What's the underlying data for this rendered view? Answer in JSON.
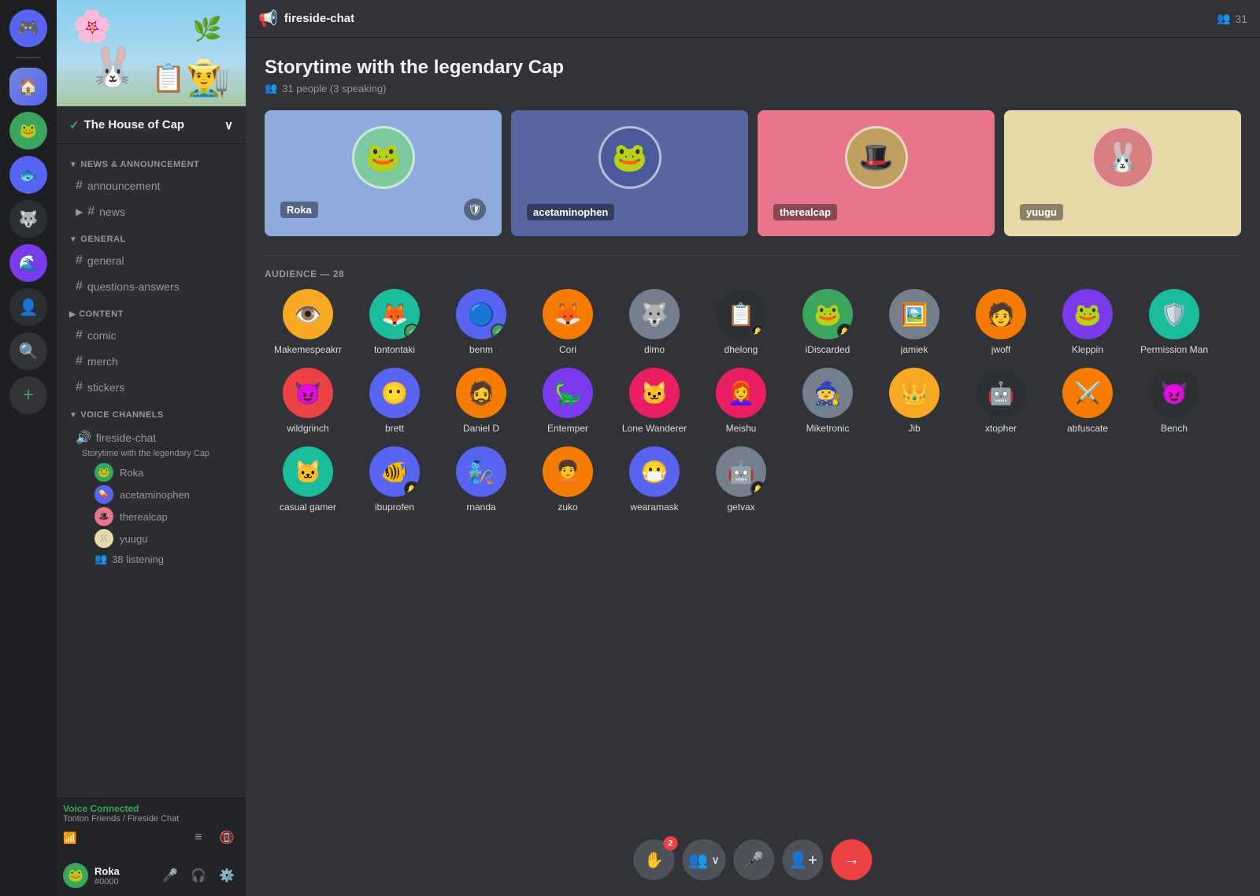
{
  "app": {
    "title": "DISCORD"
  },
  "server": {
    "name": "The House of Cap",
    "banner_alt": "Server Banner"
  },
  "channel_header": {
    "icon": "📢",
    "name": "fireside-chat",
    "members_count": "31"
  },
  "stage": {
    "title": "Storytime with the legendary Cap",
    "meta": "31 people (3 speaking)",
    "audience_label": "AUDIENCE — 28"
  },
  "speakers": [
    {
      "name": "Roka",
      "color": "blue",
      "has_badge": true
    },
    {
      "name": "acetaminophen",
      "color": "dark-blue",
      "has_badge": false
    },
    {
      "name": "therealcap",
      "color": "pink",
      "has_badge": false
    },
    {
      "name": "yuugu",
      "color": "yellow",
      "has_badge": false
    }
  ],
  "categories": {
    "news": "NEWS & ANNOUNCEMENT",
    "general": "GENERAL",
    "content": "CONTENT",
    "voice": "VOICE CHANNELS"
  },
  "channels": {
    "news_announcement": [
      {
        "name": "announcement"
      },
      {
        "name": "news"
      }
    ],
    "general": [
      {
        "name": "general"
      },
      {
        "name": "questions-answers"
      }
    ],
    "content": [
      {
        "name": "comic"
      },
      {
        "name": "merch"
      },
      {
        "name": "stickers"
      }
    ]
  },
  "voice_channel": {
    "name": "fireside-chat",
    "subtitle": "Storytime with the legendary Cap",
    "members": [
      {
        "name": "Roka"
      },
      {
        "name": "acetaminophen"
      },
      {
        "name": "therealcap"
      },
      {
        "name": "yuugu"
      }
    ],
    "listening": "38 listening"
  },
  "audience_members": [
    {
      "name": "Makemespeakrr",
      "color": "av-yellow"
    },
    {
      "name": "tontontaki",
      "color": "av-teal",
      "has_badge": true
    },
    {
      "name": "benm",
      "color": "av-blue",
      "has_badge": true
    },
    {
      "name": "Cori",
      "color": "av-orange"
    },
    {
      "name": "dimo",
      "color": "av-gray"
    },
    {
      "name": "dhelong",
      "color": "av-dark"
    },
    {
      "name": "iDiscarded",
      "color": "av-green"
    },
    {
      "name": "jamiek",
      "color": "av-gray"
    },
    {
      "name": "jwoff",
      "color": "av-orange"
    },
    {
      "name": "Kleppin",
      "color": "av-purple"
    },
    {
      "name": "Permission Man",
      "color": "av-teal"
    },
    {
      "name": "wildgrinch",
      "color": "av-red"
    },
    {
      "name": "brett",
      "color": "av-blue"
    },
    {
      "name": "Daniel D",
      "color": "av-orange"
    },
    {
      "name": "Entemper",
      "color": "av-purple"
    },
    {
      "name": "Lone Wanderer",
      "color": "av-pink"
    },
    {
      "name": "Meishu",
      "color": "av-pink"
    },
    {
      "name": "Miketronic",
      "color": "av-gray"
    },
    {
      "name": "Jib",
      "color": "av-yellow"
    },
    {
      "name": "xtopher",
      "color": "av-dark"
    },
    {
      "name": "abfuscate",
      "color": "av-orange"
    },
    {
      "name": "Bench",
      "color": "av-dark"
    },
    {
      "name": "casual gamer",
      "color": "av-teal"
    },
    {
      "name": "ibuprofen",
      "color": "av-blue",
      "has_badge": true
    },
    {
      "name": "rnanda",
      "color": "av-blue"
    },
    {
      "name": "zuko",
      "color": "av-orange"
    },
    {
      "name": "wearamask",
      "color": "av-blue"
    },
    {
      "name": "getvax",
      "color": "av-gray",
      "has_badge": true
    }
  ],
  "user": {
    "name": "Roka",
    "tag": "#0000"
  },
  "voice_connected": {
    "status": "Voice Connected",
    "location": "Tonton Friends / Fireside Chat"
  },
  "controls": {
    "raise_hand_badge": "2",
    "buttons": [
      "raise-hand",
      "invite-speaker",
      "mute",
      "add-speaker",
      "leave"
    ]
  }
}
